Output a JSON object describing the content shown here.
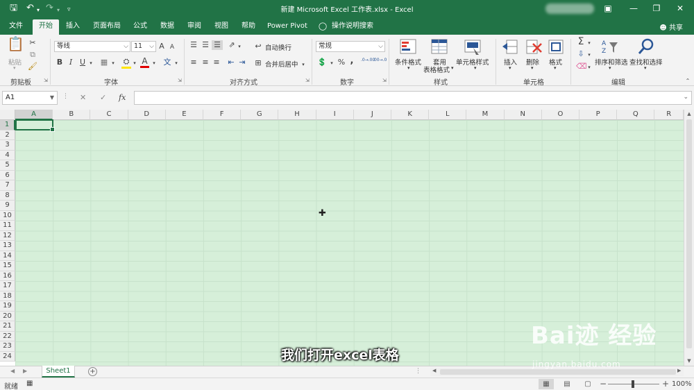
{
  "titlebar": {
    "title": "新建 Microsoft Excel 工作表.xlsx  -  Excel",
    "save_icon": "save-icon",
    "undo_icon": "undo-icon",
    "redo_icon": "redo-icon",
    "customize_icon": "customize-qat-icon"
  },
  "tabs": [
    "文件",
    "开始",
    "插入",
    "页面布局",
    "公式",
    "数据",
    "审阅",
    "视图",
    "帮助",
    "Power Pivot",
    "操作说明搜索"
  ],
  "active_tab": "开始",
  "share_label": "共享",
  "ribbon": {
    "clipboard": {
      "paste": "粘贴",
      "label": "剪贴板"
    },
    "font": {
      "name": "等线",
      "size": "11",
      "bold": "B",
      "italic": "I",
      "underline": "U",
      "grow": "A",
      "shrink": "A",
      "font_color_letter": "A",
      "phonetic": "文",
      "label": "字体"
    },
    "alignment": {
      "wrap": "自动换行",
      "merge": "合并后居中",
      "label": "对齐方式"
    },
    "number": {
      "format": "常规",
      "percent": "%",
      "comma": ",",
      "inc_decimal": ".0→.00",
      "dec_decimal": ".00→.0",
      "label": "数字"
    },
    "styles": {
      "conditional": "条件格式",
      "table_1": "套用",
      "table_2": "表格格式",
      "cell_styles": "单元格样式",
      "label": "样式"
    },
    "cells": {
      "insert": "插入",
      "delete": "删除",
      "format": "格式",
      "label": "单元格"
    },
    "editing": {
      "sort": "排序和筛选",
      "find": "查找和选择",
      "label": "编辑"
    }
  },
  "formula_bar": {
    "name_box": "A1",
    "cancel": "✕",
    "enter": "✓",
    "fx": "fx",
    "value": ""
  },
  "columns": [
    "A",
    "B",
    "C",
    "D",
    "E",
    "F",
    "G",
    "H",
    "I",
    "J",
    "K",
    "L",
    "M",
    "N",
    "O",
    "P",
    "Q",
    "R"
  ],
  "rows": [
    "1",
    "2",
    "3",
    "4",
    "5",
    "6",
    "7",
    "8",
    "9",
    "10",
    "11",
    "12",
    "13",
    "14",
    "15",
    "16",
    "17",
    "18",
    "19",
    "20",
    "21",
    "22",
    "23",
    "24"
  ],
  "selected_cell": "A1",
  "sheets": [
    "Sheet1"
  ],
  "status": {
    "ready": "就绪",
    "zoom": "100%"
  },
  "subtitle": "我们打开excel表格",
  "watermark": {
    "brand": "Bai迹 经验",
    "url": "jingyan.baidu.com"
  },
  "colors": {
    "excel_green": "#217346",
    "cell_tint": "#d6efd9"
  }
}
